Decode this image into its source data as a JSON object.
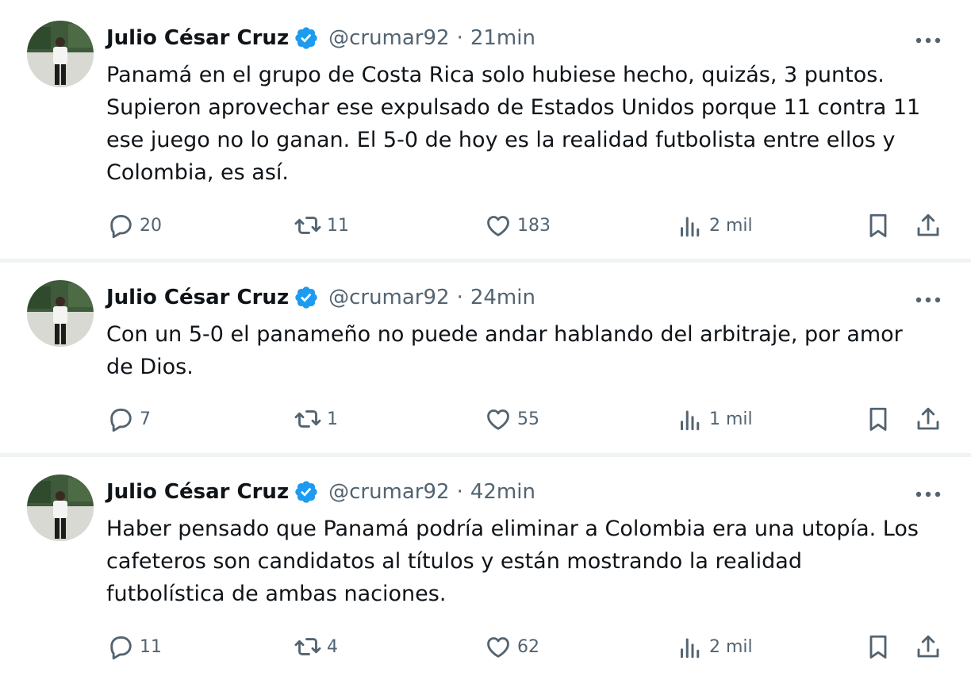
{
  "tweets": [
    {
      "name": "Julio César Cruz",
      "handle": "@crumar92",
      "separator": "·",
      "time": "21min",
      "text": "Panamá en el grupo de Costa Rica solo hubiese hecho, quizás, 3 puntos.\nSupieron aprovechar ese expulsado de Estados Unidos porque 11 contra 11\nese juego no lo ganan. El 5-0 de hoy es la realidad futbolista entre ellos y\nColombia, es así.",
      "replies": "20",
      "retweets": "11",
      "likes": "183",
      "views": "2 mil"
    },
    {
      "name": "Julio César Cruz",
      "handle": "@crumar92",
      "separator": "·",
      "time": "24min",
      "text": "Con un 5-0 el panameño no puede andar hablando del arbitraje, por amor\nde Dios.",
      "replies": "7",
      "retweets": "1",
      "likes": "55",
      "views": "1 mil"
    },
    {
      "name": "Julio César Cruz",
      "handle": "@crumar92",
      "separator": "·",
      "time": "42min",
      "text": "Haber pensado que Panamá podría eliminar a Colombia era una utopía. Los\ncafeteros son candidatos al títulos y están mostrando la realidad\nfutbolística de ambas naciones.",
      "replies": "11",
      "retweets": "4",
      "likes": "62",
      "views": "2 mil"
    }
  ],
  "icons": {
    "verified": "verified-badge-icon",
    "more": "more-options-icon",
    "reply": "reply-icon",
    "retweet": "retweet-icon",
    "like": "heart-icon",
    "views": "views-chart-icon",
    "bookmark": "bookmark-icon",
    "share": "share-icon"
  },
  "colors": {
    "verified": "#1d9bf0",
    "text": "#0f1419",
    "secondary": "#536471",
    "separator": "#eff3f4"
  }
}
